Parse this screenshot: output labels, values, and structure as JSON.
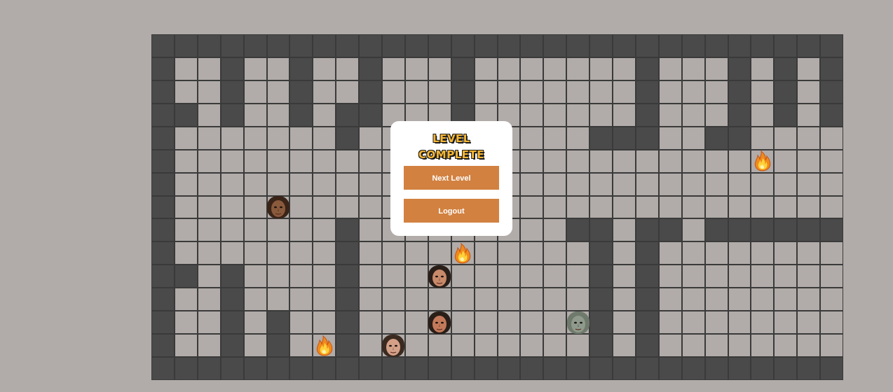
{
  "dialog": {
    "title_line1": "LEVEL",
    "title_line2": "COMPLETE",
    "next_label": "Next Level",
    "logout_label": "Logout"
  },
  "board": {
    "columns": 30,
    "rows": 15,
    "wall_color": "#4a4a4a",
    "floor_color": "#b1aca9",
    "grid": [
      "##############################",
      "#..#..#..#...#.......#...#.#.##",
      "#..#..#..#...#.......#...#.#.##",
      "##.#..#.##...#.......#...#.#.##",
      "#.......#..........###..##....#",
      "#.............................#",
      "#.............................#",
      "#.............................#",
      "#.......#.........##.##.#######",
      "#.......#..........#.#........#",
      "##.#....#..........#.#........#",
      "#..#....#..........#.#........#",
      "#..#.#..#..........#.#........#",
      "#..#.#..#..........#.#........#",
      "##############################"
    ]
  },
  "sprites": [
    {
      "kind": "face",
      "name": "player-face-icon",
      "col": 5,
      "row": 7,
      "skin": "#8a5a3c",
      "hair": "#3a2418"
    },
    {
      "kind": "face",
      "name": "enemy-face-icon",
      "col": 12,
      "row": 10,
      "skin": "#c98a6a",
      "hair": "#2a1e18"
    },
    {
      "kind": "face",
      "name": "enemy-face-icon",
      "col": 12,
      "row": 12,
      "skin": "#c47a5a",
      "hair": "#2a1e18"
    },
    {
      "kind": "face",
      "name": "enemy-face-icon",
      "col": 10,
      "row": 13,
      "skin": "#d4a088",
      "hair": "#3a2a20"
    },
    {
      "kind": "face",
      "name": "enemy-face-icon",
      "col": 18,
      "row": 12,
      "skin": "#8f9a8c",
      "hair": "#6f7a6c"
    },
    {
      "kind": "fire",
      "name": "fire-icon",
      "col": 26,
      "row": 5
    },
    {
      "kind": "fire",
      "name": "fire-icon",
      "col": 13,
      "row": 9
    },
    {
      "kind": "fire",
      "name": "fire-icon",
      "col": 7,
      "row": 13
    }
  ]
}
